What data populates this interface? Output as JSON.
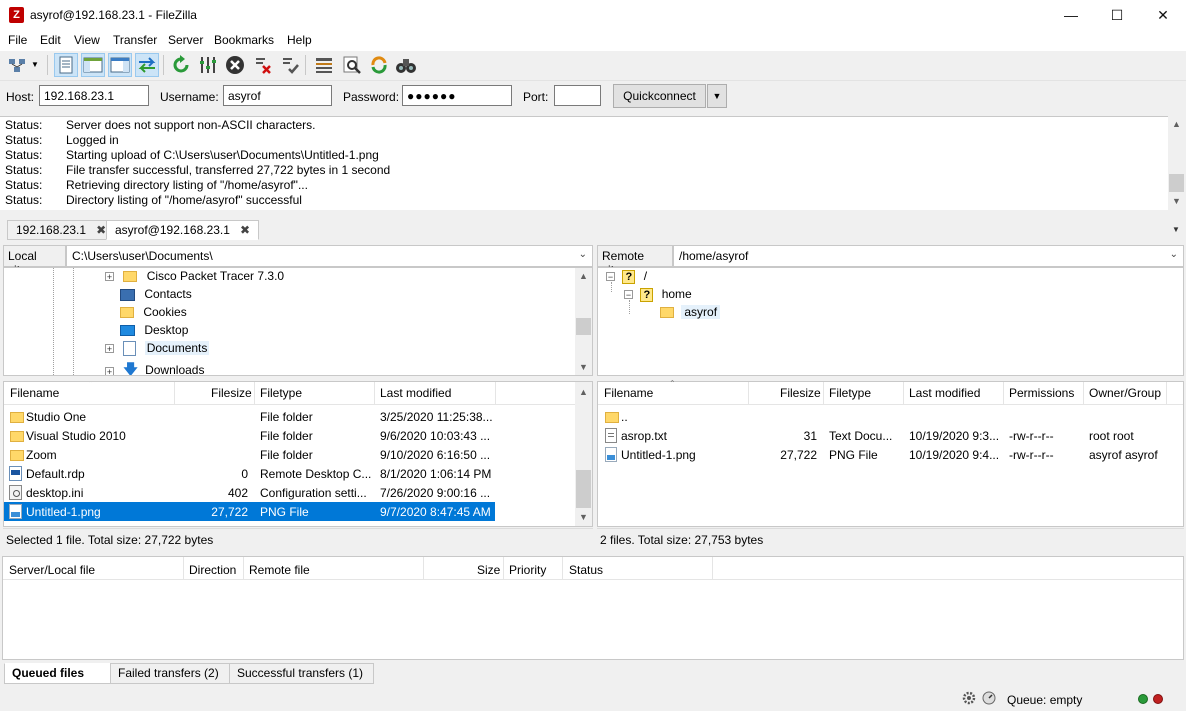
{
  "window": {
    "title": "asyrof@192.168.23.1 - FileZilla",
    "app_icon": "filezilla-icon",
    "controls": [
      "minimize-icon",
      "maximize-icon",
      "close-icon"
    ]
  },
  "menu": [
    "File",
    "Edit",
    "View",
    "Transfer",
    "Server",
    "Bookmarks",
    "Help"
  ],
  "quickconnect": {
    "host_label": "Host:",
    "host_value": "192.168.23.1",
    "username_label": "Username:",
    "username_value": "asyrof",
    "password_label": "Password:",
    "password_value": "●●●●●●",
    "port_label": "Port:",
    "port_value": "",
    "button_label": "Quickconnect"
  },
  "log": [
    {
      "k": "Status:",
      "v": "Server does not support non-ASCII characters."
    },
    {
      "k": "Status:",
      "v": "Logged in"
    },
    {
      "k": "Status:",
      "v": "Starting upload of C:\\Users\\user\\Documents\\Untitled-1.png"
    },
    {
      "k": "Status:",
      "v": "File transfer successful, transferred 27,722 bytes in 1 second"
    },
    {
      "k": "Status:",
      "v": "Retrieving directory listing of \"/home/asyrof\"..."
    },
    {
      "k": "Status:",
      "v": "Directory listing of \"/home/asyrof\" successful"
    }
  ],
  "tabs": [
    {
      "label": "192.168.23.1",
      "close": "✖"
    },
    {
      "label": "asyrof@192.168.23.1",
      "close": "✖"
    }
  ],
  "local": {
    "site_label": "Local site:",
    "site_path": "C:\\Users\\user\\Documents\\",
    "tree": [
      {
        "label": "Cisco Packet Tracer 7.3.0",
        "icon": "folder-icon",
        "expander": "+"
      },
      {
        "label": "Contacts",
        "icon": "contacts-icon",
        "expander": ""
      },
      {
        "label": "Cookies",
        "icon": "folder-icon",
        "expander": ""
      },
      {
        "label": "Desktop",
        "icon": "desktop-icon",
        "expander": ""
      },
      {
        "label": "Documents",
        "icon": "documents-icon",
        "expander": "+"
      },
      {
        "label": "Downloads",
        "icon": "downloads-icon",
        "expander": "+"
      }
    ],
    "columns": [
      "Filename",
      "Filesize",
      "Filetype",
      "Last modified"
    ],
    "files": [
      {
        "name": "Studio One",
        "size": "",
        "type": "File folder",
        "modified": "3/25/2020 11:25:38...",
        "icon": "folder-icon"
      },
      {
        "name": "Visual Studio 2010",
        "size": "",
        "type": "File folder",
        "modified": "9/6/2020 10:03:43 ...",
        "icon": "folder-icon"
      },
      {
        "name": "Zoom",
        "size": "",
        "type": "File folder",
        "modified": "9/10/2020 6:16:50 ...",
        "icon": "folder-icon"
      },
      {
        "name": "Default.rdp",
        "size": "0",
        "type": "Remote Desktop C...",
        "modified": "8/1/2020 1:06:14 PM",
        "icon": "rdp-file-icon"
      },
      {
        "name": "desktop.ini",
        "size": "402",
        "type": "Configuration setti...",
        "modified": "7/26/2020 9:00:16 ...",
        "icon": "config-file-icon"
      },
      {
        "name": "Untitled-1.png",
        "size": "27,722",
        "type": "PNG File",
        "modified": "9/7/2020 8:47:45 AM",
        "icon": "image-file-icon"
      }
    ],
    "status": "Selected 1 file. Total size: 27,722 bytes"
  },
  "remote": {
    "site_label": "Remote site:",
    "site_path": "/home/asyrof",
    "tree": [
      {
        "label": "/",
        "expander": "−"
      },
      {
        "label": "home",
        "expander": "−"
      },
      {
        "label": "asyrof",
        "expander": ""
      }
    ],
    "columns": [
      "Filename",
      "Filesize",
      "Filetype",
      "Last modified",
      "Permissions",
      "Owner/Group"
    ],
    "files": [
      {
        "name": "..",
        "size": "",
        "type": "",
        "modified": "",
        "perms": "",
        "owner": "",
        "icon": "folder-icon"
      },
      {
        "name": "asrop.txt",
        "size": "31",
        "type": "Text Docu...",
        "modified": "10/19/2020 9:3...",
        "perms": "-rw-r--r--",
        "owner": "root root",
        "icon": "text-file-icon"
      },
      {
        "name": "Untitled-1.png",
        "size": "27,722",
        "type": "PNG File",
        "modified": "10/19/2020 9:4...",
        "perms": "-rw-r--r--",
        "owner": "asyrof asyrof",
        "icon": "image-file-icon"
      }
    ],
    "status": "2 files. Total size: 27,753 bytes"
  },
  "queue": {
    "columns": [
      "Server/Local file",
      "Direction",
      "Remote file",
      "Size",
      "Priority",
      "Status"
    ],
    "tabs": [
      "Queued files",
      "Failed transfers (2)",
      "Successful transfers (1)"
    ],
    "status_text": "Queue: empty"
  }
}
